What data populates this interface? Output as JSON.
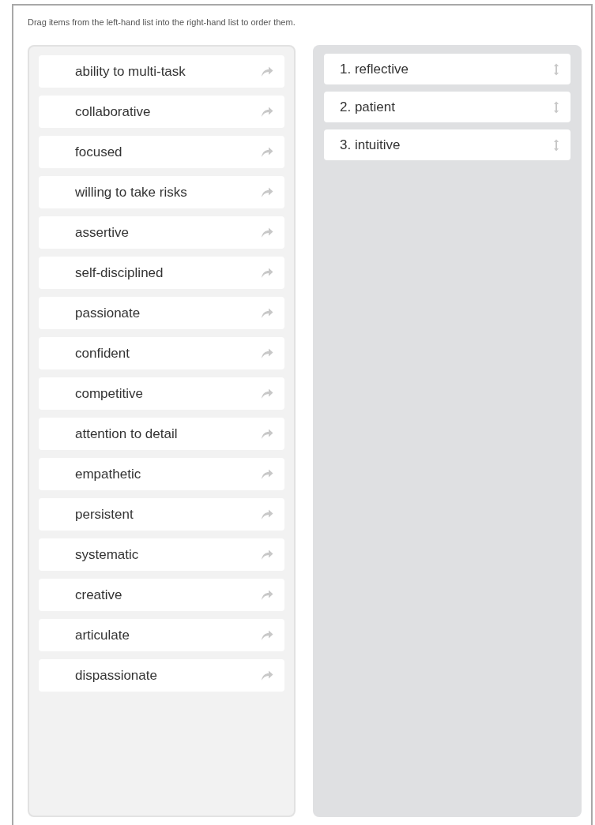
{
  "instruction": "Drag items from the left-hand list into the right-hand list to order them.",
  "available_items": [
    {
      "label": "ability to multi-task"
    },
    {
      "label": "collaborative"
    },
    {
      "label": "focused"
    },
    {
      "label": "willing to take risks"
    },
    {
      "label": "assertive"
    },
    {
      "label": "self-disciplined"
    },
    {
      "label": "passionate"
    },
    {
      "label": "confident"
    },
    {
      "label": "competitive"
    },
    {
      "label": "attention to detail"
    },
    {
      "label": "empathetic"
    },
    {
      "label": "persistent"
    },
    {
      "label": "systematic"
    },
    {
      "label": "creative"
    },
    {
      "label": "articulate"
    },
    {
      "label": "dispassionate"
    }
  ],
  "ranked_items": [
    {
      "label": "1. reflective"
    },
    {
      "label": "2. patient"
    },
    {
      "label": "3. intuitive"
    }
  ]
}
